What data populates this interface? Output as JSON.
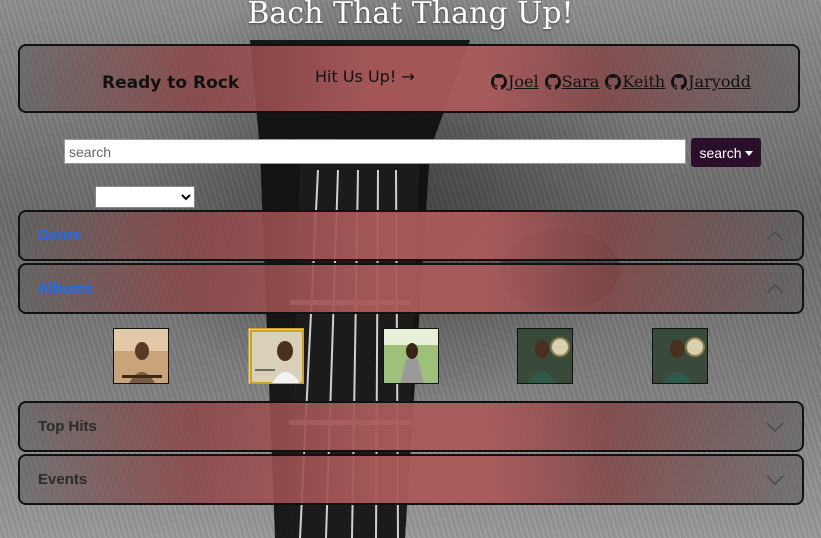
{
  "header": {
    "title": "Bach That Thang Up!"
  },
  "navbar": {
    "brand": "Ready to Rock",
    "contact": "Hit Us Up! →",
    "contributors": [
      "Joel",
      "Sara",
      "Keith",
      "Jaryodd"
    ]
  },
  "search": {
    "placeholder": "search",
    "value": "",
    "button_label": "search"
  },
  "filter_select": {
    "selected": ""
  },
  "accordion": [
    {
      "label": "Genre",
      "expanded": true
    },
    {
      "label": "Albums",
      "expanded": true
    },
    {
      "label": "Top Hits",
      "expanded": false
    },
    {
      "label": "Events",
      "expanded": false
    }
  ],
  "albums": [
    {
      "name": "album-1",
      "icon": "album-cover"
    },
    {
      "name": "album-2",
      "icon": "album-cover"
    },
    {
      "name": "album-3",
      "icon": "album-cover"
    },
    {
      "name": "album-4",
      "icon": "album-cover"
    },
    {
      "name": "album-5",
      "icon": "album-cover"
    }
  ],
  "colors": {
    "accent_link": "#1a6cff",
    "search_button": "#2a0f2b",
    "band_red": "#aa5a5a"
  }
}
